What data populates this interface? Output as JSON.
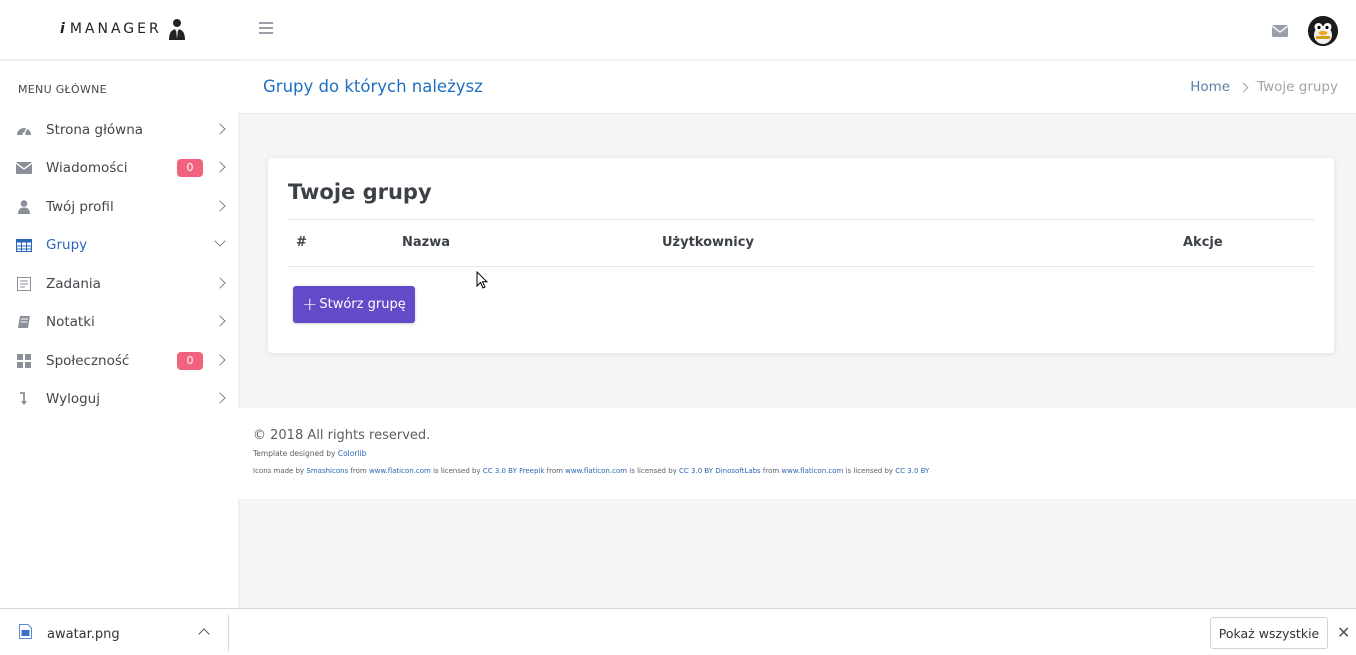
{
  "header": {
    "logo_i": "i",
    "logo_rest": "MANAGER"
  },
  "sidebar": {
    "title": "MENU GŁÓWNE",
    "items": [
      {
        "label": "Strona główna",
        "icon": "dashboard-icon"
      },
      {
        "label": "Wiadomości",
        "icon": "envelope-icon",
        "badge": "0"
      },
      {
        "label": "Twój profil",
        "icon": "user-icon"
      },
      {
        "label": "Grupy",
        "icon": "table-icon",
        "active": true
      },
      {
        "label": "Zadania",
        "icon": "task-list-icon"
      },
      {
        "label": "Notatki",
        "icon": "book-icon"
      },
      {
        "label": "Społeczność",
        "icon": "grid-icon",
        "badge": "0"
      },
      {
        "label": "Wyloguj",
        "icon": "logout-arrow-icon"
      }
    ]
  },
  "titlebar": {
    "page_title": "Grupy do których należysz",
    "breadcrumb_home": "Home",
    "breadcrumb_current": "Twoje grupy"
  },
  "card": {
    "title": "Twoje grupy",
    "columns": [
      "#",
      "Nazwa",
      "Użytkownicy",
      "Akcje"
    ],
    "create_button": "Stwórz grupę",
    "create_plus": "+"
  },
  "footer": {
    "copyright": "© 2018 All rights reserved.",
    "template_prefix": "Template designed by ",
    "template_link": "Colorlib",
    "icons_parts": [
      {
        "t": "Icons made by ",
        "link": false
      },
      {
        "t": "Smashicons",
        "link": true
      },
      {
        "t": " from ",
        "link": false
      },
      {
        "t": "www.flaticon.com",
        "link": true
      },
      {
        "t": " is licensed by ",
        "link": false
      },
      {
        "t": "CC 3.0 BY",
        "link": true
      },
      {
        "t": " ",
        "link": false
      },
      {
        "t": "Freepik",
        "link": true
      },
      {
        "t": " from ",
        "link": false
      },
      {
        "t": "www.flaticon.com",
        "link": true
      },
      {
        "t": " is licensed by ",
        "link": false
      },
      {
        "t": "CC 3.0 BY",
        "link": true
      },
      {
        "t": " ",
        "link": false
      },
      {
        "t": "DinosoftLabs",
        "link": true
      },
      {
        "t": " from ",
        "link": false
      },
      {
        "t": "www.flaticon.com",
        "link": true
      },
      {
        "t": " is licensed by ",
        "link": false
      },
      {
        "t": "CC 3.0 BY",
        "link": true
      }
    ]
  },
  "download_bar": {
    "file_name": "awatar.png",
    "show_all": "Pokaż wszystkie",
    "close": "✕"
  },
  "colors": {
    "accent": "#6449c9",
    "title_blue": "#1f6fc4",
    "badge": "#f0627e"
  }
}
